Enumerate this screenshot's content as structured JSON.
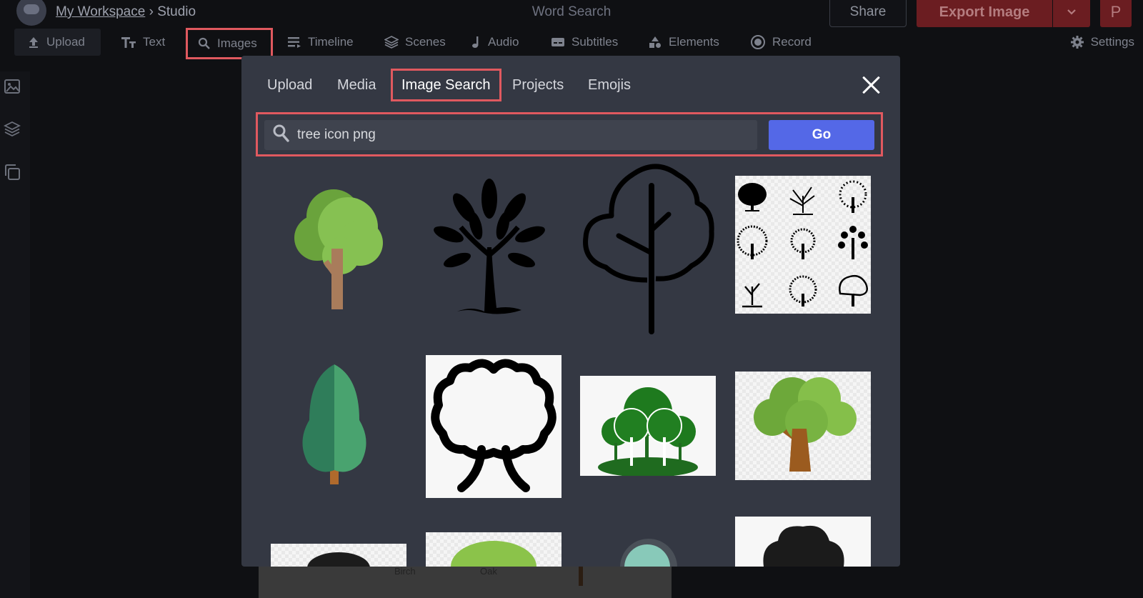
{
  "header": {
    "workspace_link": "My Workspace",
    "separator": "›",
    "current": "Studio",
    "doc_title": "Word Search",
    "share_label": "Share",
    "export_label": "Export Image",
    "user_initial": "P"
  },
  "toolbar": {
    "items": [
      {
        "label": "Upload",
        "icon": "upload-icon"
      },
      {
        "label": "Text",
        "icon": "text-icon"
      },
      {
        "label": "Images",
        "icon": "search-icon"
      },
      {
        "label": "Timeline",
        "icon": "timeline-icon"
      },
      {
        "label": "Scenes",
        "icon": "layers-icon"
      },
      {
        "label": "Audio",
        "icon": "music-note-icon"
      },
      {
        "label": "Subtitles",
        "icon": "subtitles-icon"
      },
      {
        "label": "Elements",
        "icon": "shapes-icon"
      },
      {
        "label": "Record",
        "icon": "record-icon"
      }
    ],
    "settings_label": "Settings"
  },
  "canvas_peek": {
    "labels": [
      "Birch",
      "Oak"
    ]
  },
  "modal": {
    "tabs": [
      "Upload",
      "Media",
      "Image Search",
      "Projects",
      "Emojis"
    ],
    "active_tab": "Image Search",
    "search": {
      "value": "tree icon png",
      "go_label": "Go"
    },
    "results": [
      {
        "icon": "cartoon-green-tree"
      },
      {
        "icon": "black-tree-silhouette"
      },
      {
        "icon": "outline-tree"
      },
      {
        "icon": "tree-silhouette-set"
      },
      {
        "icon": "flat-cypress-tree"
      },
      {
        "icon": "oak-outline-tree"
      },
      {
        "icon": "green-forest-trees"
      },
      {
        "icon": "flat-oak-tree"
      },
      {
        "icon": "partial-dark-tree"
      },
      {
        "icon": "partial-green-bush"
      },
      {
        "icon": "partial-teal-round-tree"
      },
      {
        "icon": "partial-black-tree"
      }
    ]
  },
  "colors": {
    "highlight": "#e0595f",
    "go_button": "#5468e7",
    "modal_bg": "#343843",
    "export_button": "#6b1d21"
  }
}
